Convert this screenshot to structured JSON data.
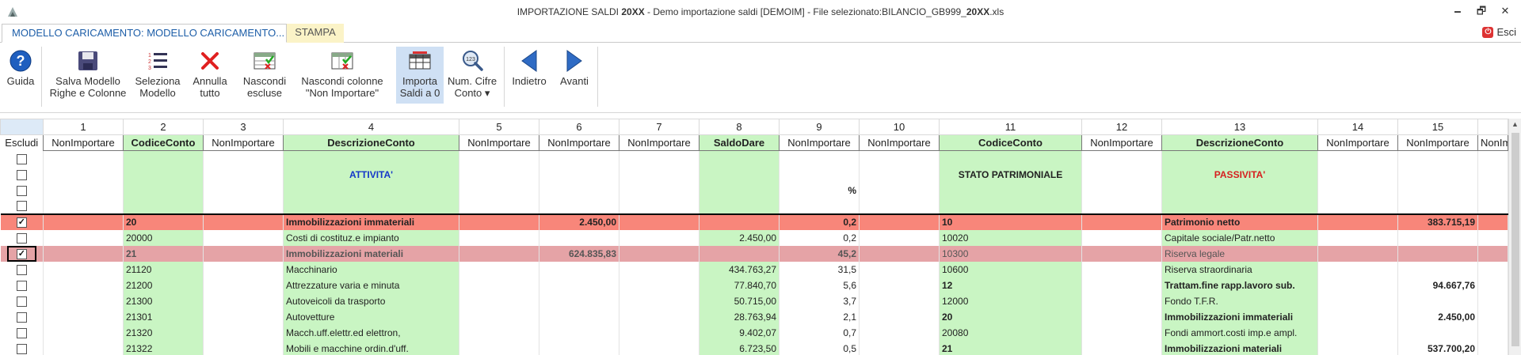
{
  "window": {
    "title_prefix": "IMPORTAZIONE SALDI ",
    "title_bold": "20XX",
    "title_rest": " - Demo importazione saldi [DEMOIM] - File selezionato:BILANCIO_GB999_",
    "title_bold2": "20XX",
    "title_suffix": ".xls",
    "minimize": "🗕",
    "restore": "🗗",
    "close": "✕"
  },
  "tabs": [
    {
      "label": "MODELLO CARICAMENTO: MODELLO CARICAMENTO..."
    },
    {
      "label": "STAMPA"
    }
  ],
  "esci_label": "Esci",
  "ribbon": [
    {
      "label": "Guida",
      "icon": "help-icon"
    },
    {
      "label": "Salva Modello\nRighe e Colonne",
      "icon": "save-icon"
    },
    {
      "label": "Seleziona\nModello",
      "icon": "list-icon"
    },
    {
      "label": "Annulla\ntutto",
      "icon": "cancel-icon"
    },
    {
      "label": "Nascondi\nescluse",
      "icon": "hide-rows-icon"
    },
    {
      "label": "Nascondi colonne\n\"Non Importare\"",
      "icon": "hide-columns-icon"
    },
    {
      "label": "Importa\nSaldi a 0",
      "icon": "import-zero-icon"
    },
    {
      "label": "Num. Cifre\nConto ▾",
      "icon": "magnifier-icon"
    },
    {
      "label": "Indietro",
      "icon": "arrow-left-icon"
    },
    {
      "label": "Avanti",
      "icon": "arrow-right-icon"
    }
  ],
  "colors": {
    "green": "#c9f5c3",
    "salmon": "#f8867a",
    "pink": "#e5a3a6",
    "blue_text": "#1437c9",
    "red_text": "#d61f1f"
  },
  "grid": {
    "col_numbers": [
      "1",
      "2",
      "3",
      "4",
      "5",
      "6",
      "7",
      "8",
      "9",
      "10",
      "11",
      "12",
      "13",
      "14",
      "15"
    ],
    "escludi": "Escludi",
    "headers": [
      "NonImportare",
      "CodiceConto",
      "NonImportare",
      "DescrizioneConto",
      "NonImportare",
      "NonImportare",
      "NonImportare",
      "SaldoDare",
      "NonImportare",
      "NonImportare",
      "CodiceConto",
      "NonImportare",
      "DescrizioneConto",
      "NonImportare",
      "NonImportare",
      "NonImportare"
    ],
    "attivita": "ATTIVITA'",
    "stato_patrimoniale": "STATO PATRIMONIALE",
    "passivita": "PASSIVITA'",
    "percent": "%",
    "rows": [
      {
        "code": "20",
        "desc": "Immobilizzazioni immateriali",
        "c6": "2.450,00",
        "c8": "",
        "c9": "0,2",
        "code2": "10",
        "desc2": "Patrimonio netto",
        "c15": "383.715,19",
        "checked": true
      },
      {
        "code": "20000",
        "desc": "Costi di costituz.e impianto",
        "c6": "",
        "c8": "2.450,00",
        "c9": "0,2",
        "code2": "10020",
        "desc2": "Capitale sociale/Patr.netto",
        "c15": "",
        "checked": false
      },
      {
        "code": "21",
        "desc": "Immobilizzazioni materiali",
        "c6": "624.835,83",
        "c8": "",
        "c9": "45,2",
        "code2": "10300",
        "desc2": "Riserva legale",
        "c15": "",
        "checked": true
      },
      {
        "code": "21120",
        "desc": "Macchinario",
        "c6": "",
        "c8": "434.763,27",
        "c9": "31,5",
        "code2": "10600",
        "desc2": "Riserva straordinaria",
        "c15": "",
        "checked": false
      },
      {
        "code": "21200",
        "desc": "Attrezzature varia e minuta",
        "c6": "",
        "c8": "77.840,70",
        "c9": "5,6",
        "code2": "12",
        "desc2": "Trattam.fine rapp.lavoro sub.",
        "c15": "94.667,76",
        "checked": false
      },
      {
        "code": "21300",
        "desc": "Autoveicoli da trasporto",
        "c6": "",
        "c8": "50.715,00",
        "c9": "3,7",
        "code2": "12000",
        "desc2": "Fondo T.F.R.",
        "c15": "",
        "checked": false
      },
      {
        "code": "21301",
        "desc": "Autovetture",
        "c6": "",
        "c8": "28.763,94",
        "c9": "2,1",
        "code2": "20",
        "desc2": "Immobilizzazioni immateriali",
        "c15": "2.450,00",
        "checked": false
      },
      {
        "code": "21320",
        "desc": "Macch.uff.elettr.ed elettron,",
        "c6": "",
        "c8": "9.402,07",
        "c9": "0,7",
        "code2": "20080",
        "desc2": "Fondi ammort.costi imp.e ampl.",
        "c15": "",
        "checked": false
      },
      {
        "code": "21322",
        "desc": "Mobili e macchine ordin.d'uff.",
        "c6": "",
        "c8": "6.723,50",
        "c9": "0,5",
        "code2": "21",
        "desc2": "Immobilizzazioni materiali",
        "c15": "537.700,20",
        "checked": false
      }
    ]
  }
}
